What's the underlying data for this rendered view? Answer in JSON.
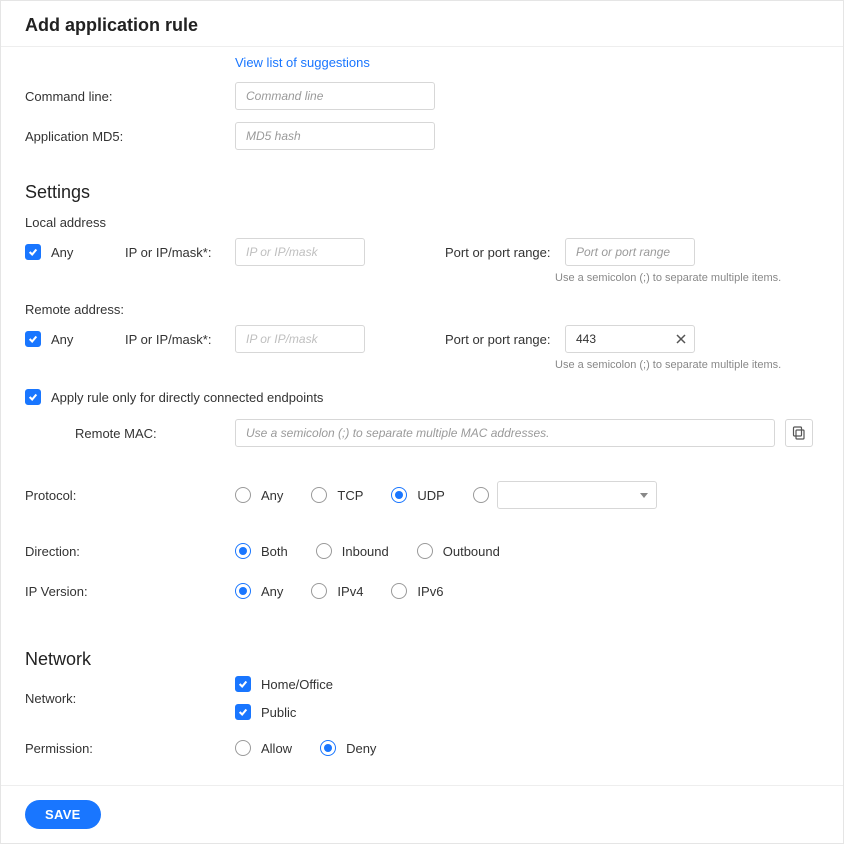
{
  "header": {
    "title": "Add application rule"
  },
  "top": {
    "suggestions_link": "View list of suggestions",
    "cmdline_label": "Command line:",
    "cmdline_placeholder": "Command line",
    "md5_label": "Application MD5:",
    "md5_placeholder": "MD5 hash"
  },
  "settings": {
    "title": "Settings",
    "local_addr_label": "Local address",
    "remote_addr_label": "Remote address:",
    "any_label": "Any",
    "ip_label": "IP or IP/mask*:",
    "ip_placeholder": "IP or IP/mask",
    "port_label": "Port or port range:",
    "port_placeholder": "Port or port range",
    "semicolon_hint": "Use a semicolon (;) to separate multiple items.",
    "local_any_checked": true,
    "remote_any_checked": true,
    "remote_port_value": "443",
    "direct_endpoints_label": "Apply rule only for directly connected endpoints",
    "direct_endpoints_checked": true,
    "remote_mac_label": "Remote MAC:",
    "remote_mac_placeholder": "Use a semicolon (;) to separate multiple MAC addresses.",
    "protocol_label": "Protocol:",
    "protocol_options": {
      "any": "Any",
      "tcp": "TCP",
      "udp": "UDP"
    },
    "protocol_selected": "udp",
    "direction_label": "Direction:",
    "direction_options": {
      "both": "Both",
      "in": "Inbound",
      "out": "Outbound"
    },
    "direction_selected": "both",
    "ipver_label": "IP Version:",
    "ipver_options": {
      "any": "Any",
      "v4": "IPv4",
      "v6": "IPv6"
    },
    "ipver_selected": "any"
  },
  "network": {
    "title": "Network",
    "network_label": "Network:",
    "home_label": "Home/Office",
    "home_checked": true,
    "public_label": "Public",
    "public_checked": true,
    "permission_label": "Permission:",
    "permission_options": {
      "allow": "Allow",
      "deny": "Deny"
    },
    "permission_selected": "deny"
  },
  "footer": {
    "save": "SAVE"
  }
}
